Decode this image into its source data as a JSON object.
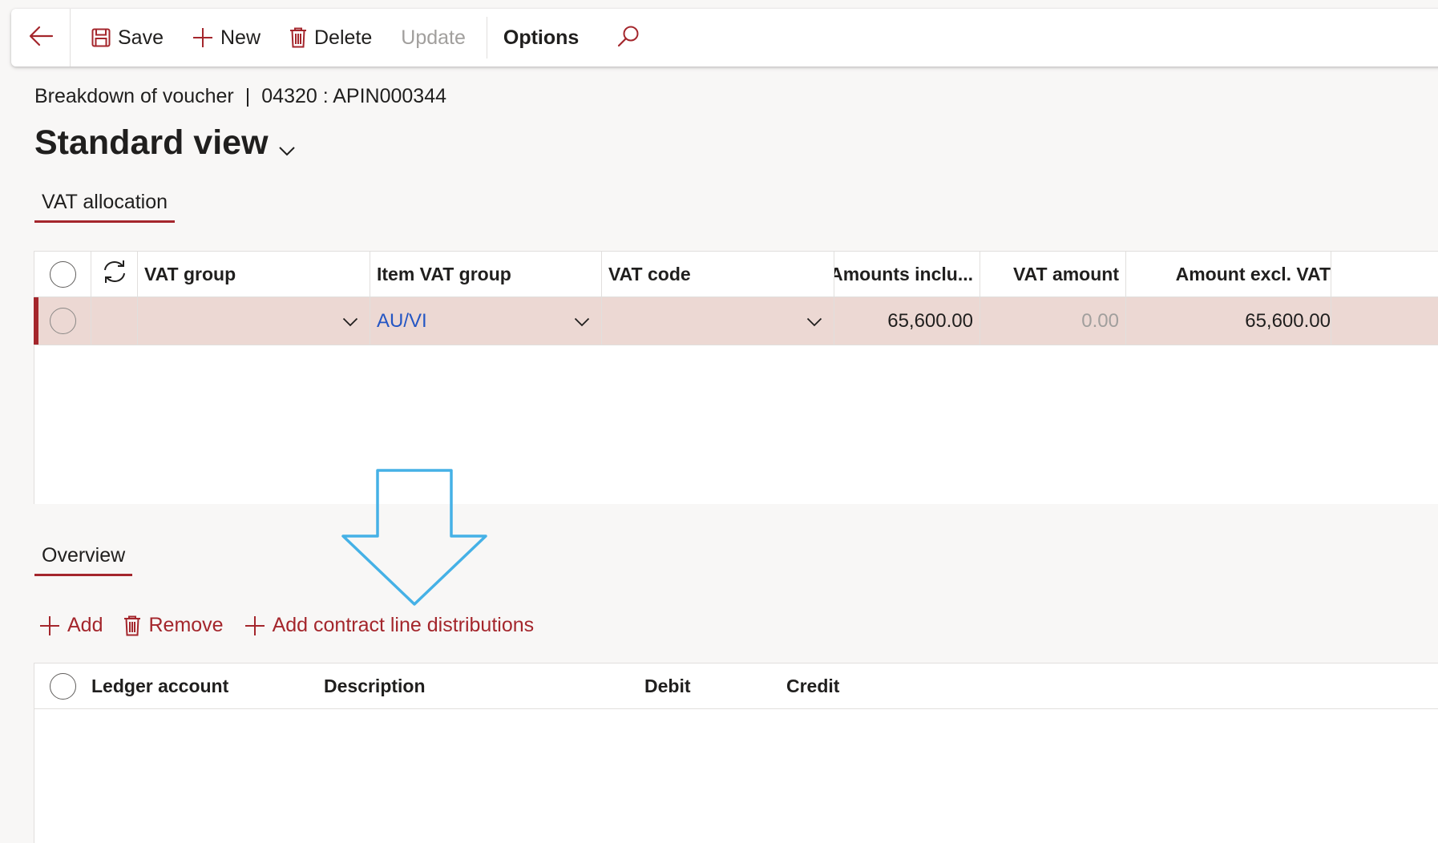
{
  "toolbar": {
    "save_label": "Save",
    "new_label": "New",
    "delete_label": "Delete",
    "update_label": "Update",
    "options_label": "Options"
  },
  "header": {
    "breadcrumb_title": "Breakdown of voucher",
    "breadcrumb_separator": "|",
    "breadcrumb_record": "04320 : APIN000344",
    "view_name": "Standard view"
  },
  "vat_allocation": {
    "tab_label": "VAT allocation",
    "columns": {
      "vat_group": "VAT group",
      "item_vat_group": "Item VAT group",
      "vat_code": "VAT code",
      "amounts_incl": "Amounts inclu...",
      "vat_amount": "VAT amount",
      "amount_excl": "Amount excl. VAT"
    },
    "rows": [
      {
        "vat_group": "",
        "item_vat_group": "AU/VI",
        "vat_code": "",
        "amounts_incl": "65,600.00",
        "vat_amount": "0.00",
        "amount_excl": "65,600.00"
      }
    ]
  },
  "overview": {
    "tab_label": "Overview",
    "add_label": "Add",
    "remove_label": "Remove",
    "add_contract_label": "Add contract line distributions",
    "columns": {
      "ledger_account": "Ledger account",
      "description": "Description",
      "debit": "Debit",
      "credit": "Credit"
    }
  },
  "colors": {
    "accent": "#a4262c",
    "selected_row": "#ecd8d3",
    "link": "#2456c4",
    "annotation_arrow": "#45b1e6"
  },
  "icons": {
    "back": "arrow-left-icon",
    "save": "save-icon",
    "new": "plus-icon",
    "delete": "trash-icon",
    "search": "search-icon",
    "refresh": "refresh-icon",
    "dropdown": "chevron-down-icon"
  }
}
